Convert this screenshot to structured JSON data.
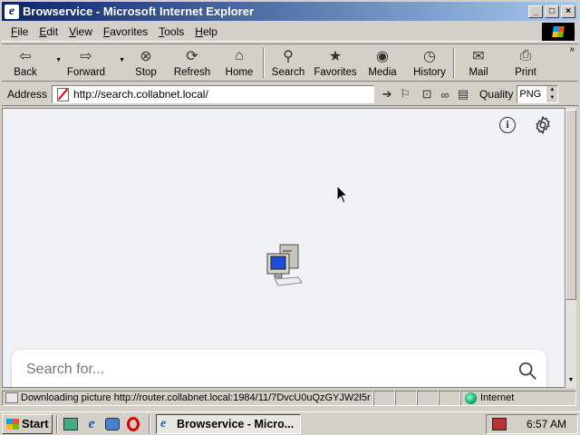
{
  "window": {
    "title": "Browservice - Microsoft Internet Explorer",
    "icon": "ie-icon"
  },
  "menu": {
    "items": [
      {
        "label": "File",
        "u": "F",
        "rest": "ile"
      },
      {
        "label": "Edit",
        "u": "E",
        "rest": "dit"
      },
      {
        "label": "View",
        "u": "V",
        "rest": "iew"
      },
      {
        "label": "Favorites",
        "u": "F",
        "rest": "avorites",
        "pre": ""
      },
      {
        "label": "Tools",
        "u": "T",
        "rest": "ools"
      },
      {
        "label": "Help",
        "u": "H",
        "rest": "elp"
      }
    ]
  },
  "toolbar": {
    "back": "Back",
    "forward": "Forward",
    "stop": "Stop",
    "refresh": "Refresh",
    "home": "Home",
    "search": "Search",
    "favorites": "Favorites",
    "media": "Media",
    "history": "History",
    "mail": "Mail",
    "print": "Print",
    "more": "»"
  },
  "address": {
    "label": "Address",
    "url": "http://search.collabnet.local/"
  },
  "quality": {
    "label": "Quality",
    "value": "PNG"
  },
  "page": {
    "search_placeholder": "Search for...",
    "info_label": "i"
  },
  "status": {
    "text": "Downloading picture http://router.collabnet.local:1984/11/7DvcU0uQzGYJW2l5r",
    "zone": "Internet"
  },
  "taskbar": {
    "start": "Start",
    "task": "Browservice - Micro...",
    "clock": "6:57 AM"
  },
  "colors": {
    "titlebar_start": "#0a246a",
    "titlebar_end": "#a6caf0",
    "chrome": "#d4d0c8",
    "content_bg": "#f0f2f5"
  }
}
